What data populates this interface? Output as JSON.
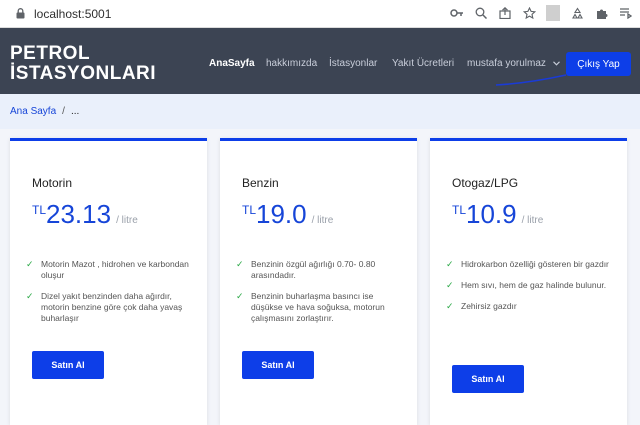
{
  "browser": {
    "url": "localhost:5001"
  },
  "header": {
    "brand_line1": "PETROL",
    "brand_line2": "İSTASYONLARI",
    "nav": [
      "AnaSayfa",
      "hakkımızda",
      "İstasyonlar",
      "Yakıt Ücretleri"
    ],
    "user": "mustafa yorulmaz",
    "logout": "Çıkış Yap"
  },
  "breadcrumb": {
    "home": "Ana Sayfa",
    "separator": "/",
    "current": "..."
  },
  "cards": [
    {
      "title": "Motorin",
      "currency": "TL",
      "price": "23.13",
      "unit": "/ litre",
      "features": [
        "Motorin Mazot , hidrohen ve karbondan oluşur",
        "Dizel yakıt benzinden daha ağırdır, motorin benzine göre çok daha yavaş buharlaşır"
      ],
      "button": "Satın Al"
    },
    {
      "title": "Benzin",
      "currency": "TL",
      "price": "19.0",
      "unit": "/ litre",
      "features": [
        "Benzinin özgül ağırlığı 0.70- 0.80 arasındadır.",
        "Benzinin buharlaşma basıncı ise düşükse ve hava soğuksa, motorun çalışmasını zorlaştırır."
      ],
      "button": "Satın Al"
    },
    {
      "title": "Otogaz/LPG",
      "currency": "TL",
      "price": "10.9",
      "unit": "/ litre",
      "features": [
        "Hidrokarbon özelliği gösteren bir gazdır",
        "Hem sıvı, hem de gaz halinde bulunur.",
        "Zehirsiz gazdır"
      ],
      "button": "Satın Al"
    }
  ],
  "colors": {
    "header_bg": "#3c4453",
    "accent": "#0d3ee8",
    "check": "#28a745",
    "breadcrumb_bg": "#eaf0fb"
  }
}
